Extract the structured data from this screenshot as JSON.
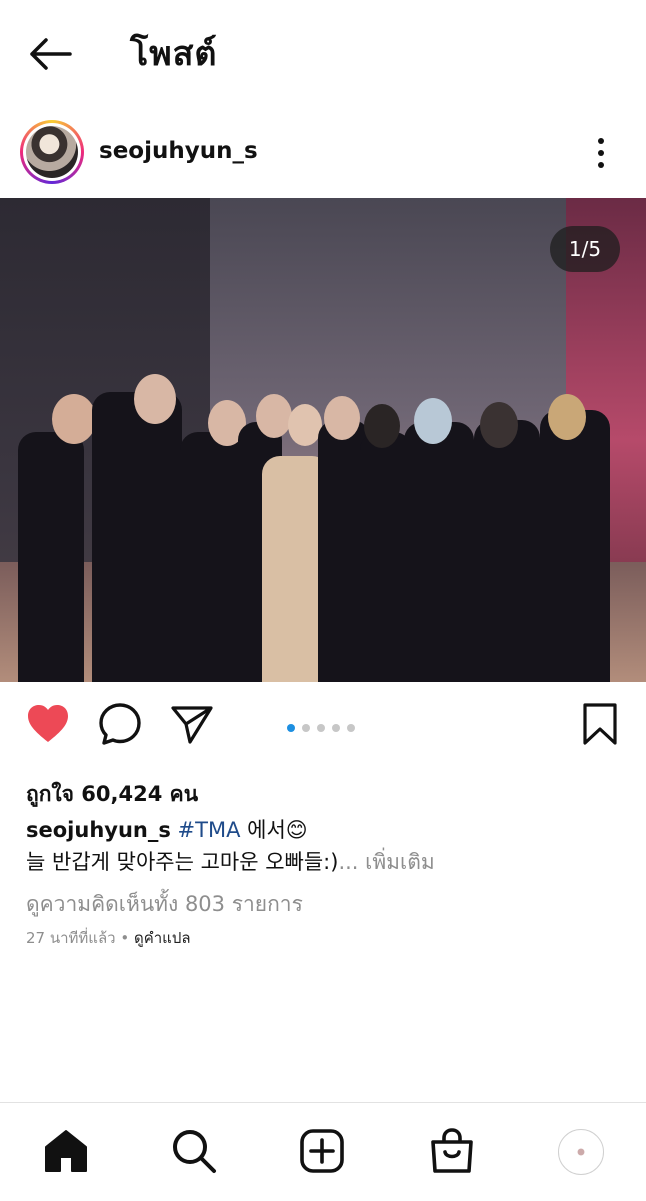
{
  "header": {
    "title": "โพสต์",
    "back_icon": "arrow-left-icon"
  },
  "post": {
    "username": "seojuhyun_s",
    "photo_counter": "1/5",
    "carousel": {
      "total": 5,
      "active_index": 0
    },
    "likes_text": "ถูกใจ 60,424 คน",
    "caption": {
      "username": "seojuhyun_s",
      "hashtag": "#TMA",
      "text_line1": " 에서😊",
      "text_line2": "늘 반갑게 맞아주는 고마운 오빠들:)",
      "more": "... เพิ่มเติม"
    },
    "view_comments": "ดูความคิดเห็นทั้ง 803 รายการ",
    "time_ago": "27 นาทีที่แล้ว",
    "separator": " • ",
    "translate": "ดูคำแปล"
  },
  "colors": {
    "like": "#ed4956",
    "active_dot": "#1d8fe1",
    "hashtag": "#1f4b8a"
  },
  "icons": {
    "actions": [
      "heart-filled-icon",
      "comment-icon",
      "share-icon",
      "bookmark-icon"
    ],
    "nav": [
      "home-icon",
      "search-icon",
      "new-post-icon",
      "shop-icon",
      "profile-avatar"
    ]
  }
}
